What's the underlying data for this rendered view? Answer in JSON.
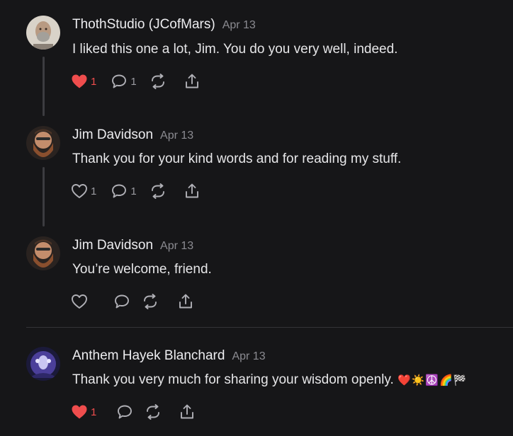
{
  "comments": [
    {
      "author": "ThothStudio (JCofMars)",
      "date": "Apr 13",
      "text": "I liked this one a lot, Jim. You do you very well, indeed.",
      "likes": "1",
      "replies": "1",
      "liked": true
    },
    {
      "author": "Jim Davidson",
      "date": "Apr 13",
      "text": "Thank you for your kind words and for reading my stuff.",
      "likes": "1",
      "replies": "1",
      "liked": false
    },
    {
      "author": "Jim Davidson",
      "date": "Apr 13",
      "text": "You’re welcome, friend.",
      "liked": false
    },
    {
      "author": "Anthem Hayek Blanchard",
      "date": "Apr 13",
      "text": "Thank you very much for sharing your wisdom openly.",
      "emoji": "❤️☀️☮️🌈🏁",
      "likes": "1",
      "liked": true
    }
  ],
  "colors": {
    "background": "#161618",
    "like_active": "#ef4d4d",
    "icon": "#9a9aa0",
    "thread_line": "#3c3c40"
  },
  "icons": {
    "like": "heart-icon",
    "reply": "speech-bubble-icon",
    "restack": "restack-icon",
    "share": "share-icon"
  }
}
